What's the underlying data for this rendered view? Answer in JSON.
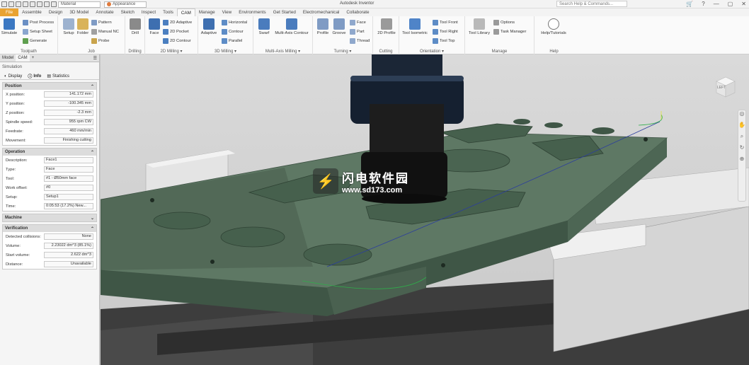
{
  "titlebar": {
    "material": "Material",
    "appearance": "Appearance",
    "app_title": "Autodesk Inventor",
    "search_placeholder": "Search Help & Commands..."
  },
  "tabs": [
    "File",
    "Assemble",
    "Design",
    "3D Model",
    "Annotate",
    "Sketch",
    "Inspect",
    "Tools",
    "CAM",
    "Manage",
    "View",
    "Environments",
    "Get Started",
    "Electromechanical",
    "Collaborate"
  ],
  "ribbon": {
    "toolpath": {
      "label": "Toolpath",
      "simulate": "Simulate",
      "post_process": "Post Process",
      "setup_sheet": "Setup Sheet",
      "generate": "Generate"
    },
    "job": {
      "label": "Job",
      "setup": "Setup",
      "folder": "Folder",
      "pattern": "Pattern",
      "manual_nc": "Manual NC",
      "probe": "Probe"
    },
    "drilling": {
      "label": "Drilling",
      "drill": "Drill"
    },
    "milling2d": {
      "label": "2D Milling ▾",
      "face": "Face",
      "adaptive": "2D Adaptive",
      "pocket": "2D Pocket",
      "contour": "2D Contour"
    },
    "milling3d": {
      "label": "3D Milling ▾",
      "adaptive": "Adaptive",
      "horizontal": "Horizontal",
      "contour": "Contour",
      "parallel": "Parallel"
    },
    "multiaxis": {
      "label": "Multi-Axis Milling ▾",
      "swarf": "Swarf",
      "contour": "Multi-Axis Contour"
    },
    "turning": {
      "label": "Turning ▾",
      "profile": "Profile",
      "groove": "Groove",
      "face": "Face",
      "part": "Part",
      "thread": "Thread"
    },
    "cutting": {
      "label": "Cutting",
      "profile": "2D Profile"
    },
    "orientation": {
      "label": "Orientation ▾",
      "isometric": "Tool Isometric",
      "front": "Tool Front",
      "right": "Tool Right",
      "top": "Tool Top"
    },
    "manage": {
      "label": "Manage",
      "library": "Tool Library",
      "options": "Options",
      "task_manager": "Task Manager"
    },
    "help": {
      "label": "Help",
      "tutorials": "Help/Tutorials"
    }
  },
  "browser": {
    "tabs": [
      "Model",
      "CAM",
      "+"
    ],
    "header": "Simulation",
    "subtabs": [
      "Display",
      "Info",
      "Statistics"
    ],
    "position": {
      "title": "Position",
      "rows": [
        {
          "label": "X position:",
          "value": "141.172 mm"
        },
        {
          "label": "Y position:",
          "value": "-100.345 mm"
        },
        {
          "label": "Z position:",
          "value": "-2.3 mm"
        },
        {
          "label": "Spindle speed:",
          "value": "955 rpm CW"
        },
        {
          "label": "Feedrate:",
          "value": "460 mm/min"
        },
        {
          "label": "Movement:",
          "value": "Finishing cutting"
        }
      ]
    },
    "operation": {
      "title": "Operation",
      "rows": [
        {
          "label": "Description:",
          "value": "Face1"
        },
        {
          "label": "Type:",
          "value": "Face"
        },
        {
          "label": "Tool:",
          "value": "#1 - Ø50mm face"
        },
        {
          "label": "Work offset:",
          "value": "#0"
        },
        {
          "label": "Setup:",
          "value": "Setup1"
        },
        {
          "label": "Time:",
          "value": "0:05:53 (17.2%) New..."
        }
      ]
    },
    "machine": {
      "title": "Machine"
    },
    "verification": {
      "title": "Verification",
      "rows": [
        {
          "label": "Detected collisions:",
          "value": "None"
        },
        {
          "label": "Volume:",
          "value": "2.23022 dm^3 (85.1%)"
        },
        {
          "label": "Start volume:",
          "value": "2.622 dm^3"
        },
        {
          "label": "Distance:",
          "value": "Unavailable"
        }
      ]
    }
  },
  "viewcube": {
    "label": "LEFT"
  },
  "watermark": {
    "cn": "闪电软件园",
    "url": "www.sd173.com"
  }
}
